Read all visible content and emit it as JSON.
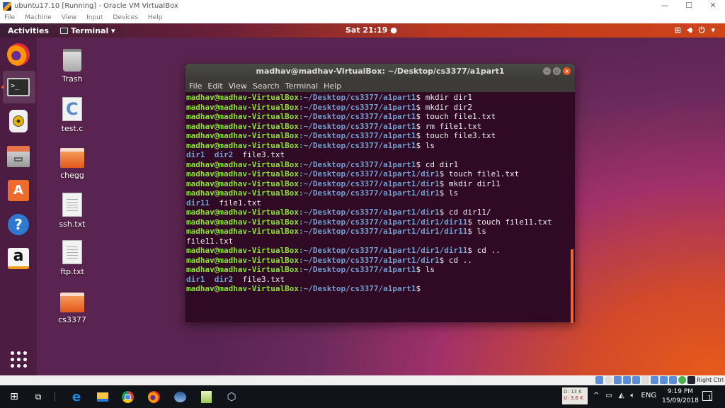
{
  "virtualbox": {
    "window_title": "ubuntu17.10 [Running] - Oracle VM VirtualBox",
    "window_controls": [
      "—",
      "☐",
      "✕"
    ],
    "menu": [
      "File",
      "Machine",
      "View",
      "Input",
      "Devices",
      "Help"
    ],
    "status_host_key": "Right Ctrl"
  },
  "ubuntu_topbar": {
    "activities": "Activities",
    "app_menu": "Terminal ▾",
    "clock": "Sat 21:19 ●",
    "tray": [
      "network-icon",
      "volume-icon",
      "power-icon",
      "dropdown-icon"
    ]
  },
  "dock": {
    "items": [
      {
        "name": "firefox",
        "icon": "firefox-icon"
      },
      {
        "name": "terminal",
        "icon": "terminal-icon",
        "active": true
      },
      {
        "name": "rhythmbox",
        "icon": "speaker-icon"
      },
      {
        "name": "files",
        "icon": "file-cabinet-icon"
      },
      {
        "name": "ubuntu-software",
        "icon": "shopping-bag-icon"
      },
      {
        "name": "help",
        "icon": "help-icon"
      },
      {
        "name": "amazon",
        "icon": "amazon-icon"
      },
      {
        "name": "show-applications",
        "icon": "app-grid-icon"
      }
    ],
    "terminal_glyph": ">_",
    "store_glyph": "A",
    "help_glyph": "?",
    "amazon_glyph": "a"
  },
  "desktop_icons": [
    {
      "label": "Trash",
      "type": "trash"
    },
    {
      "label": "test.c",
      "type": "c-source"
    },
    {
      "label": "chegg",
      "type": "folder"
    },
    {
      "label": "ssh.txt",
      "type": "text"
    },
    {
      "label": "ftp.txt",
      "type": "text"
    },
    {
      "label": "cs3377",
      "type": "folder"
    }
  ],
  "terminal": {
    "title": "madhav@madhav-VirtualBox: ~/Desktop/cs3377/a1part1",
    "menu": [
      "File",
      "Edit",
      "View",
      "Search",
      "Terminal",
      "Help"
    ],
    "user_host": "madhav@madhav-VirtualBox",
    "lines": [
      {
        "kind": "prompt",
        "path": "~/Desktop/cs3377/a1part1",
        "cmd": "mkdir dir1"
      },
      {
        "kind": "prompt",
        "path": "~/Desktop/cs3377/a1part1",
        "cmd": "mkdir dir2"
      },
      {
        "kind": "prompt",
        "path": "~/Desktop/cs3377/a1part1",
        "cmd": "touch file1.txt"
      },
      {
        "kind": "prompt",
        "path": "~/Desktop/cs3377/a1part1",
        "cmd": "rm file1.txt"
      },
      {
        "kind": "prompt",
        "path": "~/Desktop/cs3377/a1part1",
        "cmd": "touch file3.txt"
      },
      {
        "kind": "prompt",
        "path": "~/Desktop/cs3377/a1part1",
        "cmd": "ls"
      },
      {
        "kind": "output",
        "dirs": [
          "dir1",
          "dir2"
        ],
        "files": [
          "file3.txt"
        ]
      },
      {
        "kind": "prompt",
        "path": "~/Desktop/cs3377/a1part1",
        "cmd": "cd dir1"
      },
      {
        "kind": "prompt",
        "path": "~/Desktop/cs3377/a1part1/dir1",
        "cmd": "touch file1.txt"
      },
      {
        "kind": "prompt",
        "path": "~/Desktop/cs3377/a1part1/dir1",
        "cmd": "mkdir dir11"
      },
      {
        "kind": "prompt",
        "path": "~/Desktop/cs3377/a1part1/dir1",
        "cmd": "ls"
      },
      {
        "kind": "output",
        "dirs": [
          "dir11"
        ],
        "files": [
          "file1.txt"
        ]
      },
      {
        "kind": "prompt",
        "path": "~/Desktop/cs3377/a1part1/dir1",
        "cmd": "cd dir11/"
      },
      {
        "kind": "prompt",
        "path": "~/Desktop/cs3377/a1part1/dir1/dir11",
        "cmd": "touch file11.txt"
      },
      {
        "kind": "prompt",
        "path": "~/Desktop/cs3377/a1part1/dir1/dir11",
        "cmd": "ls"
      },
      {
        "kind": "output",
        "dirs": [],
        "files": [
          "file11.txt"
        ]
      },
      {
        "kind": "prompt",
        "path": "~/Desktop/cs3377/a1part1/dir1/dir11",
        "cmd": "cd .."
      },
      {
        "kind": "prompt",
        "path": "~/Desktop/cs3377/a1part1/dir1",
        "cmd": "cd .."
      },
      {
        "kind": "prompt",
        "path": "~/Desktop/cs3377/a1part1",
        "cmd": "ls"
      },
      {
        "kind": "output",
        "dirs": [
          "dir1",
          "dir2"
        ],
        "files": [
          "file3.txt"
        ]
      },
      {
        "kind": "prompt",
        "path": "~/Desktop/cs3377/a1part1",
        "cmd": ""
      }
    ],
    "colors": {
      "background": "#300a24",
      "user": "#8ae234",
      "path": "#729fcf",
      "accent": "#e95420"
    }
  },
  "windows_taskbar": {
    "pinned": [
      "start-icon",
      "task-view-icon",
      "edge-icon",
      "file-explorer-icon",
      "chrome-icon",
      "firefox-icon",
      "thunderbird-icon",
      "notepad-icon",
      "virtualbox-icon"
    ],
    "net_widget": {
      "down": "D: 13 K",
      "up": "U: 3.6 K"
    },
    "tray": [
      "^",
      "battery-icon",
      "wifi-icon",
      "volume-icon"
    ],
    "language": "ENG",
    "time": "9:19 PM",
    "date": "15/09/2018",
    "notifications": "1"
  }
}
